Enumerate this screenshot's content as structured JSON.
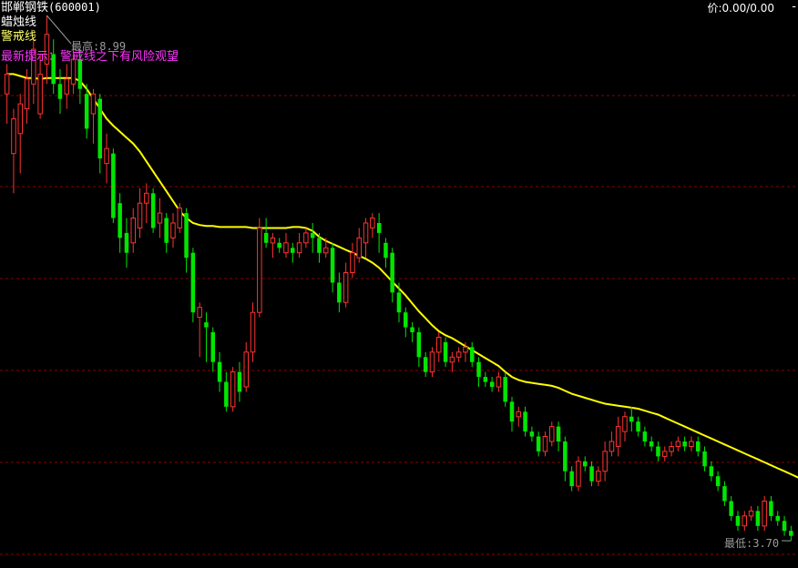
{
  "header": {
    "stock_name": "邯郸钢铁",
    "stock_code": "(600001)",
    "price_label": "价:0.00/0.00",
    "minimize_glyph": "-"
  },
  "indicators": {
    "candle_label": "蜡烛线",
    "warning_line_label": "警戒线",
    "hint": "最新提示：警戒线之下有风险观望"
  },
  "annotations": {
    "high": "最高:8.99",
    "low": "最低:3.70"
  },
  "colors": {
    "background": "#000000",
    "up": "#ff3232",
    "down": "#00e600",
    "warning_line": "#ffff00",
    "grid": "#8b0000",
    "annotation": "#9a9a9a",
    "hint": "#ff33ff"
  },
  "chart_data": {
    "type": "candlestick",
    "grid": "dashed horizontal",
    "ylim": [
      3.6,
      9.1
    ],
    "high_value": 8.99,
    "low_value": 3.7,
    "candles": [
      [
        8.2,
        8.4,
        8.5,
        7.9
      ],
      [
        7.6,
        7.95,
        8.05,
        7.2
      ],
      [
        7.8,
        8.1,
        8.2,
        7.4
      ],
      [
        8.05,
        8.35,
        8.45,
        7.9
      ],
      [
        8.3,
        8.65,
        8.75,
        8.1
      ],
      [
        8.0,
        8.4,
        8.6,
        7.95
      ],
      [
        8.5,
        8.8,
        8.99,
        8.3
      ],
      [
        8.6,
        8.3,
        8.75,
        8.2
      ],
      [
        8.3,
        8.15,
        8.45,
        8.0
      ],
      [
        8.2,
        8.35,
        8.5,
        8.05
      ],
      [
        8.3,
        8.55,
        8.7,
        8.2
      ],
      [
        8.55,
        8.25,
        8.65,
        8.1
      ],
      [
        8.2,
        7.85,
        8.3,
        7.75
      ],
      [
        8.0,
        8.2,
        8.25,
        7.7
      ],
      [
        8.15,
        7.55,
        8.2,
        7.4
      ],
      [
        7.5,
        7.65,
        7.8,
        7.3
      ],
      [
        7.6,
        6.95,
        7.65,
        6.9
      ],
      [
        7.1,
        6.75,
        7.2,
        6.6
      ],
      [
        6.8,
        6.6,
        6.95,
        6.45
      ],
      [
        6.7,
        6.95,
        7.05,
        6.6
      ],
      [
        6.85,
        7.1,
        7.25,
        6.75
      ],
      [
        7.1,
        7.2,
        7.3,
        6.9
      ],
      [
        7.2,
        6.85,
        7.25,
        6.8
      ],
      [
        6.9,
        7.0,
        7.15,
        6.75
      ],
      [
        6.95,
        6.7,
        7.0,
        6.6
      ],
      [
        6.75,
        6.9,
        7.0,
        6.65
      ],
      [
        6.85,
        7.05,
        7.1,
        6.8
      ],
      [
        7.0,
        6.55,
        7.05,
        6.4
      ],
      [
        6.6,
        6.0,
        6.65,
        5.9
      ],
      [
        5.95,
        6.05,
        6.1,
        5.55
      ],
      [
        5.9,
        5.85,
        6.0,
        5.5
      ],
      [
        5.8,
        5.5,
        5.85,
        5.4
      ],
      [
        5.5,
        5.3,
        5.6,
        5.2
      ],
      [
        5.3,
        5.05,
        5.4,
        5.0
      ],
      [
        5.05,
        5.4,
        5.45,
        5.0
      ],
      [
        5.4,
        5.2,
        5.5,
        5.1
      ],
      [
        5.25,
        5.6,
        5.7,
        5.2
      ],
      [
        5.6,
        6.0,
        6.1,
        5.5
      ],
      [
        6.0,
        6.85,
        6.95,
        5.95
      ],
      [
        6.8,
        6.7,
        6.95,
        6.65
      ],
      [
        6.7,
        6.75,
        6.8,
        6.55
      ],
      [
        6.7,
        6.65,
        6.75,
        6.6
      ],
      [
        6.6,
        6.7,
        6.8,
        6.55
      ],
      [
        6.65,
        6.6,
        6.7,
        6.5
      ],
      [
        6.6,
        6.7,
        6.8,
        6.55
      ],
      [
        6.7,
        6.8,
        6.85,
        6.65
      ],
      [
        6.8,
        6.75,
        6.9,
        6.6
      ],
      [
        6.75,
        6.6,
        6.8,
        6.5
      ],
      [
        6.6,
        6.65,
        6.75,
        6.55
      ],
      [
        6.65,
        6.3,
        6.7,
        6.2
      ],
      [
        6.3,
        6.1,
        6.4,
        6.0
      ],
      [
        6.1,
        6.4,
        6.5,
        6.05
      ],
      [
        6.4,
        6.6,
        6.7,
        6.35
      ],
      [
        6.55,
        6.75,
        6.85,
        6.5
      ],
      [
        6.7,
        6.9,
        6.95,
        6.55
      ],
      [
        6.85,
        6.95,
        7.0,
        6.75
      ],
      [
        6.9,
        6.8,
        7.0,
        6.6
      ],
      [
        6.7,
        6.55,
        6.75,
        6.45
      ],
      [
        6.6,
        6.2,
        6.65,
        6.1
      ],
      [
        6.2,
        6.0,
        6.3,
        5.9
      ],
      [
        6.0,
        5.85,
        6.05,
        5.75
      ],
      [
        5.85,
        5.8,
        5.9,
        5.7
      ],
      [
        5.8,
        5.55,
        5.85,
        5.45
      ],
      [
        5.55,
        5.4,
        5.6,
        5.35
      ],
      [
        5.4,
        5.6,
        5.65,
        5.35
      ],
      [
        5.6,
        5.75,
        5.8,
        5.5
      ],
      [
        5.7,
        5.5,
        5.75,
        5.45
      ],
      [
        5.5,
        5.55,
        5.6,
        5.4
      ],
      [
        5.55,
        5.6,
        5.65,
        5.5
      ],
      [
        5.6,
        5.65,
        5.7,
        5.5
      ],
      [
        5.65,
        5.5,
        5.7,
        5.45
      ],
      [
        5.5,
        5.35,
        5.55,
        5.25
      ],
      [
        5.35,
        5.3,
        5.4,
        5.25
      ],
      [
        5.3,
        5.25,
        5.35,
        5.2
      ],
      [
        5.25,
        5.35,
        5.4,
        5.2
      ],
      [
        5.35,
        5.1,
        5.4,
        5.05
      ],
      [
        5.1,
        4.9,
        5.15,
        4.8
      ],
      [
        4.95,
        5.0,
        5.05,
        4.85
      ],
      [
        5.0,
        4.8,
        5.05,
        4.75
      ],
      [
        4.8,
        4.75,
        4.85,
        4.7
      ],
      [
        4.75,
        4.6,
        4.8,
        4.55
      ],
      [
        4.6,
        4.75,
        4.8,
        4.55
      ],
      [
        4.7,
        4.85,
        4.9,
        4.65
      ],
      [
        4.85,
        4.7,
        4.9,
        4.6
      ],
      [
        4.7,
        4.4,
        4.75,
        4.3
      ],
      [
        4.4,
        4.25,
        4.45,
        4.2
      ],
      [
        4.25,
        4.5,
        4.55,
        4.2
      ],
      [
        4.5,
        4.45,
        4.55,
        4.4
      ],
      [
        4.45,
        4.3,
        4.5,
        4.25
      ],
      [
        4.3,
        4.4,
        4.45,
        4.25
      ],
      [
        4.4,
        4.6,
        4.7,
        4.3
      ],
      [
        4.6,
        4.7,
        4.8,
        4.55
      ],
      [
        4.65,
        4.85,
        4.95,
        4.55
      ],
      [
        4.8,
        4.95,
        5.0,
        4.7
      ],
      [
        4.95,
        4.9,
        5.05,
        4.8
      ],
      [
        4.9,
        4.8,
        4.95,
        4.75
      ],
      [
        4.8,
        4.7,
        4.85,
        4.65
      ],
      [
        4.7,
        4.65,
        4.75,
        4.6
      ],
      [
        4.65,
        4.55,
        4.7,
        4.5
      ],
      [
        4.55,
        4.6,
        4.65,
        4.5
      ],
      [
        4.6,
        4.65,
        4.7,
        4.55
      ],
      [
        4.65,
        4.7,
        4.75,
        4.6
      ],
      [
        4.7,
        4.65,
        4.75,
        4.6
      ],
      [
        4.65,
        4.7,
        4.75,
        4.6
      ],
      [
        4.7,
        4.6,
        4.75,
        4.55
      ],
      [
        4.6,
        4.45,
        4.65,
        4.4
      ],
      [
        4.45,
        4.35,
        4.5,
        4.3
      ],
      [
        4.35,
        4.25,
        4.4,
        4.2
      ],
      [
        4.25,
        4.1,
        4.3,
        4.05
      ],
      [
        4.1,
        3.95,
        4.15,
        3.9
      ],
      [
        3.95,
        3.85,
        4.0,
        3.8
      ],
      [
        3.85,
        3.95,
        4.0,
        3.8
      ],
      [
        3.95,
        4.0,
        4.05,
        3.9
      ],
      [
        4.0,
        3.85,
        4.05,
        3.8
      ],
      [
        3.85,
        4.1,
        4.15,
        3.8
      ],
      [
        4.1,
        3.95,
        4.15,
        3.9
      ],
      [
        3.95,
        3.9,
        4.0,
        3.85
      ],
      [
        3.9,
        3.8,
        3.95,
        3.75
      ],
      [
        3.8,
        3.75,
        3.85,
        3.7
      ]
    ],
    "warning_line": [
      8.4,
      8.4,
      8.38,
      8.36,
      8.36,
      8.35,
      8.36,
      8.36,
      8.36,
      8.36,
      8.36,
      8.33,
      8.25,
      8.15,
      8.05,
      7.95,
      7.88,
      7.82,
      7.76,
      7.7,
      7.62,
      7.52,
      7.42,
      7.32,
      7.22,
      7.12,
      7.02,
      6.95,
      6.9,
      6.88,
      6.87,
      6.87,
      6.86,
      6.86,
      6.86,
      6.86,
      6.86,
      6.85,
      6.85,
      6.85,
      6.85,
      6.85,
      6.85,
      6.86,
      6.86,
      6.85,
      6.82,
      6.76,
      6.72,
      6.69,
      6.66,
      6.63,
      6.6,
      6.57,
      6.54,
      6.5,
      6.45,
      6.38,
      6.31,
      6.24,
      6.17,
      6.09,
      6.01,
      5.94,
      5.87,
      5.81,
      5.77,
      5.74,
      5.7,
      5.66,
      5.62,
      5.58,
      5.54,
      5.5,
      5.46,
      5.4,
      5.35,
      5.32,
      5.3,
      5.29,
      5.28,
      5.27,
      5.26,
      5.24,
      5.21,
      5.18,
      5.16,
      5.14,
      5.12,
      5.1,
      5.08,
      5.07,
      5.06,
      5.05,
      5.04,
      5.03,
      5.01,
      4.99,
      4.97,
      4.94,
      4.91,
      4.88,
      4.85,
      4.82,
      4.79,
      4.76,
      4.73,
      4.7,
      4.67,
      4.64,
      4.61,
      4.58,
      4.55,
      4.52,
      4.49,
      4.46,
      4.43,
      4.4,
      4.37,
      4.34,
      4.31
    ]
  }
}
